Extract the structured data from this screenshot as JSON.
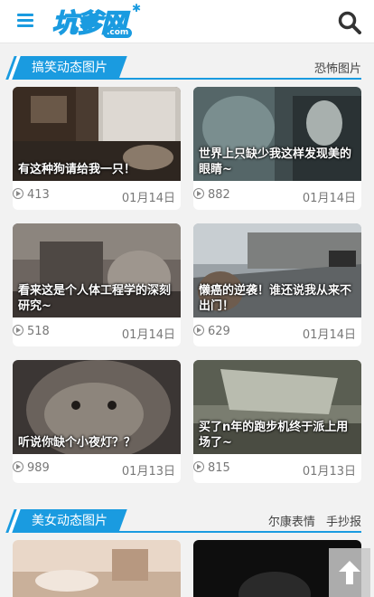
{
  "header": {
    "logo_text": "坑爹网",
    "logo_sub": ".com",
    "menu_icon": "menu-icon",
    "search_icon": "search-icon"
  },
  "section1": {
    "title": "搞笑动态图片",
    "links": [
      "恐怖图片"
    ]
  },
  "section2": {
    "title": "美女动态图片",
    "links": [
      "尔康表情",
      "手抄报"
    ]
  },
  "cards": [
    {
      "caption": "有这种狗请给我一只！",
      "views": "413",
      "date": "01月14日"
    },
    {
      "caption": "世界上只缺少我这样发现美的眼睛~",
      "views": "882",
      "date": "01月14日"
    },
    {
      "caption": "看来这是个人体工程学的深刻研究~",
      "views": "518",
      "date": "01月14日"
    },
    {
      "caption": "懒癌的逆袭！谁还说我从来不出门！",
      "views": "629",
      "date": "01月14日"
    },
    {
      "caption": "听说你缺个小夜灯？？",
      "views": "989",
      "date": "01月13日"
    },
    {
      "caption": "买了n年的跑步机终于派上用场了~",
      "views": "815",
      "date": "01月13日"
    }
  ],
  "colors": {
    "accent": "#1a9be0"
  }
}
